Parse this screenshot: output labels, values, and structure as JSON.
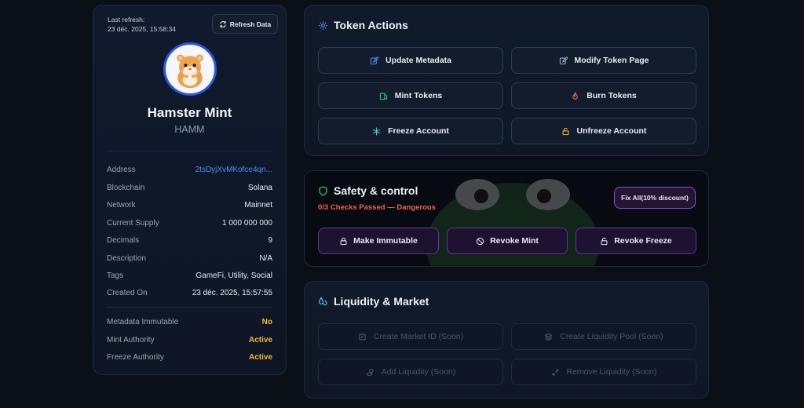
{
  "refresh": {
    "label": "Last refresh:",
    "timestamp": "23 déc. 2025, 15:58:34",
    "button": "Refresh Data"
  },
  "token": {
    "name": "Hamster Mint",
    "symbol": "HAMM",
    "avatar_icon": "hamster-logo"
  },
  "details": [
    {
      "key": "Address",
      "value": "2tsDyjXvMKofce4qn...",
      "style": "link"
    },
    {
      "key": "Blockchain",
      "value": "Solana",
      "style": ""
    },
    {
      "key": "Network",
      "value": "Mainnet",
      "style": ""
    },
    {
      "key": "Current Supply",
      "value": "1 000 000 000",
      "style": ""
    },
    {
      "key": "Decimals",
      "value": "9",
      "style": ""
    },
    {
      "key": "Description",
      "value": "N/A",
      "style": ""
    },
    {
      "key": "Tags",
      "value": "GameFi, Utility, Social",
      "style": ""
    },
    {
      "key": "Created On",
      "value": "23 déc. 2025, 15:57:55",
      "style": ""
    }
  ],
  "authorities": [
    {
      "key": "Metadata Immutable",
      "value": "No",
      "style": "warn"
    },
    {
      "key": "Mint Authority",
      "value": "Active",
      "style": "warn"
    },
    {
      "key": "Freeze Authority",
      "value": "Active",
      "style": "warn"
    }
  ],
  "token_actions": {
    "title": "Token Actions",
    "buttons": [
      "Update Metadata",
      "Modify Token Page",
      "Mint Tokens",
      "Burn Tokens",
      "Freeze Account",
      "Unfreeze Account"
    ]
  },
  "safety": {
    "title": "Safety & control",
    "status": "0/3 Checks Passed — Dangerous",
    "fix_all": "Fix All(10% discount)",
    "buttons": [
      "Make Immutable",
      "Revoke Mint",
      "Revoke Freeze"
    ]
  },
  "liquidity": {
    "title": "Liquidity & Market",
    "buttons": [
      "Create Market ID (Soon)",
      "Create Liquidity Pool (Soon)",
      "Add Liquidity (Soon)",
      "Remove Liquidity (Soon)"
    ]
  },
  "colors": {
    "accent_blue": "#4d8ef5",
    "warning": "#f5b72a",
    "danger": "#f0614e",
    "purple": "#8a4fd1"
  }
}
